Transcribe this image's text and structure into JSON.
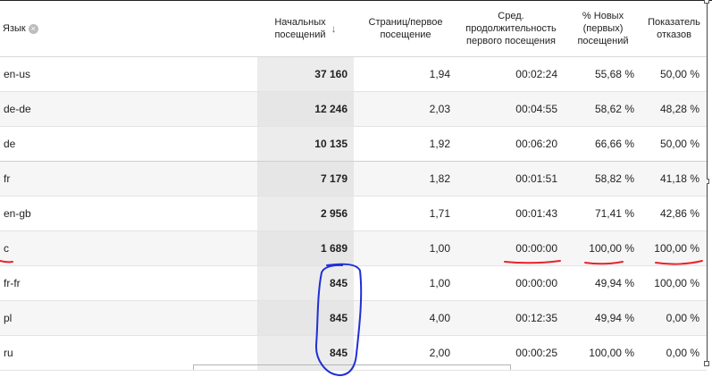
{
  "table": {
    "headers": {
      "language": "Язык",
      "sessions_line1": "Начальных",
      "sessions_line2": "посещений",
      "pages_line1": "Страниц/первое",
      "pages_line2": "посещение",
      "duration_line1": "Сред.",
      "duration_line2": "продолжительность",
      "duration_line3": "первого посещения",
      "new_line1": "% Новых",
      "new_line2": "(первых)",
      "new_line3": "посещений",
      "bounce_line1": "Показатель",
      "bounce_line2": "отказов"
    },
    "clear_glyph": "×",
    "sort_glyph": "↓",
    "rows": [
      {
        "lang": "en-us",
        "sessions": "37 160",
        "pages": "1,94",
        "duration": "00:02:24",
        "new": "55,68 %",
        "bounce": "50,00 %"
      },
      {
        "lang": "de-de",
        "sessions": "12 246",
        "pages": "2,03",
        "duration": "00:04:55",
        "new": "58,62 %",
        "bounce": "48,28 %"
      },
      {
        "lang": "de",
        "sessions": "10 135",
        "pages": "1,92",
        "duration": "00:06:20",
        "new": "66,66 %",
        "bounce": "50,00 %"
      },
      {
        "lang": "fr",
        "sessions": "7 179",
        "pages": "1,82",
        "duration": "00:01:51",
        "new": "58,82 %",
        "bounce": "41,18 %"
      },
      {
        "lang": "en-gb",
        "sessions": "2 956",
        "pages": "1,71",
        "duration": "00:01:43",
        "new": "71,41 %",
        "bounce": "42,86 %"
      },
      {
        "lang": "c",
        "sessions": "1 689",
        "pages": "1,00",
        "duration": "00:00:00",
        "new": "100,00 %",
        "bounce": "100,00 %"
      },
      {
        "lang": "fr-fr",
        "sessions": "845",
        "pages": "1,00",
        "duration": "00:00:00",
        "new": "49,94 %",
        "bounce": "100,00 %"
      },
      {
        "lang": "pl",
        "sessions": "845",
        "pages": "4,00",
        "duration": "00:12:35",
        "new": "49,94 %",
        "bounce": "0,00 %"
      },
      {
        "lang": "ru",
        "sessions": "845",
        "pages": "2,00",
        "duration": "00:00:25",
        "new": "100,00 %",
        "bounce": "0,00 %"
      }
    ]
  },
  "annotations": {
    "underline_color": "#e8222a",
    "circle_color": "#1f2fd6"
  }
}
